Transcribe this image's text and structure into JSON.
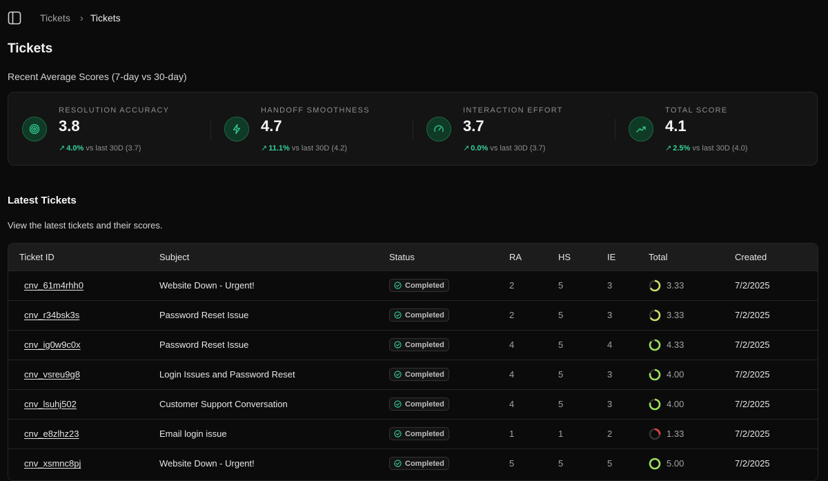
{
  "breadcrumb": {
    "items": [
      "Tickets",
      "Tickets"
    ],
    "separator": "›"
  },
  "page": {
    "title": "Tickets"
  },
  "scores": {
    "subtitle": "Recent Average Scores (7-day vs 30-day)",
    "metrics": [
      {
        "label": "RESOLUTION ACCURACY",
        "value": "3.8",
        "change": "4.0%",
        "comparison": "vs last 30D (3.7)",
        "icon": "target-icon"
      },
      {
        "label": "HANDOFF SMOOTHNESS",
        "value": "4.7",
        "change": "11.1%",
        "comparison": "vs last 30D (4.2)",
        "icon": "lightning-icon"
      },
      {
        "label": "INTERACTION EFFORT",
        "value": "3.7",
        "change": "0.0%",
        "comparison": "vs last 30D (3.7)",
        "icon": "gauge-icon"
      },
      {
        "label": "TOTAL SCORE",
        "value": "4.1",
        "change": "2.5%",
        "comparison": "vs last 30D (4.0)",
        "icon": "trending-up-icon"
      }
    ]
  },
  "latest": {
    "title": "Latest Tickets",
    "subtitle": "View the latest tickets and their scores.",
    "columns": [
      "Ticket ID",
      "Subject",
      "Status",
      "RA",
      "HS",
      "IE",
      "Total",
      "Created"
    ],
    "rows": [
      {
        "id": "cnv_61m4rhh0",
        "subject": "Website Down - Urgent!",
        "status": "Completed",
        "ra": "2",
        "hs": "5",
        "ie": "3",
        "total": "3.33",
        "total_fraction": 0.667,
        "created": "7/2/2025"
      },
      {
        "id": "cnv_r34bsk3s",
        "subject": "Password Reset Issue",
        "status": "Completed",
        "ra": "2",
        "hs": "5",
        "ie": "3",
        "total": "3.33",
        "total_fraction": 0.667,
        "created": "7/2/2025"
      },
      {
        "id": "cnv_ig0w9c0x",
        "subject": "Password Reset Issue",
        "status": "Completed",
        "ra": "4",
        "hs": "5",
        "ie": "4",
        "total": "4.33",
        "total_fraction": 0.867,
        "created": "7/2/2025"
      },
      {
        "id": "cnv_vsreu9g8",
        "subject": "Login Issues and Password Reset",
        "status": "Completed",
        "ra": "4",
        "hs": "5",
        "ie": "3",
        "total": "4.00",
        "total_fraction": 0.8,
        "created": "7/2/2025"
      },
      {
        "id": "cnv_lsuhj502",
        "subject": "Customer Support Conversation",
        "status": "Completed",
        "ra": "4",
        "hs": "5",
        "ie": "3",
        "total": "4.00",
        "total_fraction": 0.8,
        "created": "7/2/2025"
      },
      {
        "id": "cnv_e8zlhz23",
        "subject": "Email login issue",
        "status": "Completed",
        "ra": "1",
        "hs": "1",
        "ie": "2",
        "total": "1.33",
        "total_fraction": 0.267,
        "created": "7/2/2025"
      },
      {
        "id": "cnv_xsmnc8pj",
        "subject": "Website Down - Urgent!",
        "status": "Completed",
        "ra": "5",
        "hs": "5",
        "ie": "5",
        "total": "5.00",
        "total_fraction": 1.0,
        "created": "7/2/2025"
      }
    ]
  },
  "colors": {
    "accent": "#34d399",
    "ring_good": "#9be15d",
    "ring_mid": "#c8e06a",
    "ring_low": "#ef4444",
    "ring_track": "#333333"
  }
}
